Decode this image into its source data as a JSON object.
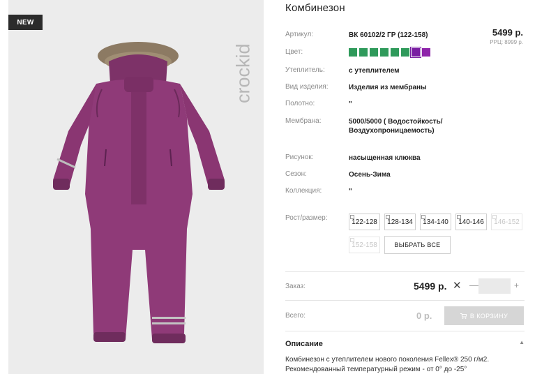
{
  "badge": {
    "new": "NEW"
  },
  "brand": {
    "logo_text": "crockid"
  },
  "product": {
    "title": "Комбинезон",
    "price": "5499 р.",
    "rrp": "РРЦ: 8999 р."
  },
  "specs": [
    {
      "label": "Артикул:",
      "value": "ВК 60102/2 ГР (122-158)"
    },
    {
      "label": "Цвет:",
      "value": ""
    },
    {
      "label": "Утеплитель:",
      "value": "с утеплителем"
    },
    {
      "label": "Вид изделия:",
      "value": "Изделия из мембраны"
    },
    {
      "label": "Полотно:",
      "value": "\""
    },
    {
      "label": "Мембрана:",
      "value": "5000/5000 ( Водостойкость/ Воздухопроницаемость)"
    },
    {
      "label": "Рисунок:",
      "value": "насыщенная клюква"
    },
    {
      "label": "Сезон:",
      "value": "Осень-Зима"
    },
    {
      "label": "Коллекция:",
      "value": "\""
    },
    {
      "label": "Рост/размер:",
      "value": ""
    }
  ],
  "colors": {
    "swatches": [
      "#2f9a5b",
      "#2f9a5b",
      "#2f9a5b",
      "#2f9a5b",
      "#2f9a5b",
      "#2f9a5b",
      "#7a1fa2",
      "#8e24aa"
    ],
    "selected_index": 6,
    "photo_main": "#8f3a78",
    "photo_dark": "#6f2c5d",
    "photo_fur": "#8c7a63"
  },
  "sizes": [
    {
      "label": "122-128",
      "available": true
    },
    {
      "label": "128-134",
      "available": true
    },
    {
      "label": "134-140",
      "available": true
    },
    {
      "label": "140-146",
      "available": true
    },
    {
      "label": "146-152",
      "available": false
    },
    {
      "label": "152-158",
      "available": false
    }
  ],
  "select_all_label": "ВЫБРАТЬ ВСЕ",
  "order": {
    "label": "Заказ:",
    "price": "5499 р.",
    "times": "✕",
    "minus": "—",
    "plus": "+",
    "quantity": ""
  },
  "total": {
    "label": "Всего:",
    "value": "0 р.",
    "cart_label": "В КОРЗИНУ"
  },
  "description": {
    "title": "Описание",
    "toggle": "▲",
    "text_line1": "Комбинезон с утеплителем нового поколения Fellex® 250 г/м2.",
    "text_line2": "Рекомендованный температурный режим - от 0° до -25°"
  },
  "icons": {
    "cart": "cart-icon",
    "collapse": "chevron-up-icon",
    "close": "times-icon"
  }
}
